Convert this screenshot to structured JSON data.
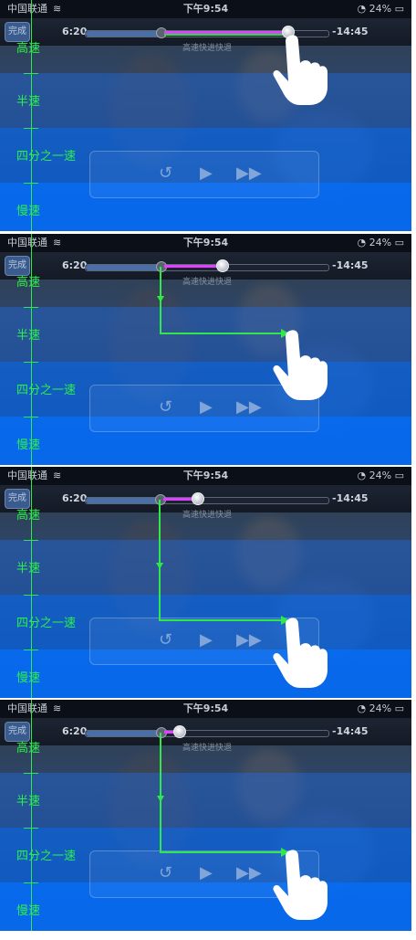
{
  "statusbar": {
    "carrier": "中国联通",
    "time": "下午9:54",
    "battery": "24%"
  },
  "player": {
    "done_label": "完成",
    "elapsed": "6:20",
    "remaining": "-14:45",
    "speed_caption": "高速快进快退"
  },
  "speed_labels": [
    "高速",
    "半速",
    "四分之一速",
    "慢速"
  ],
  "panels": [
    {
      "scrub_fraction": 0.85,
      "speed": "高速"
    },
    {
      "scrub_fraction": 0.33,
      "speed": "半速"
    },
    {
      "scrub_fraction": 0.19,
      "speed": "四分之一速"
    },
    {
      "scrub_fraction": 0.1,
      "speed": "四分之一速"
    }
  ],
  "colors": {
    "accent_green": "#2fe84a",
    "scrub_pink": "#e040ff",
    "band_blue": "#0a6ef0"
  },
  "icons": [
    "wifi-icon",
    "battery-icon",
    "replay-30-icon",
    "play-icon",
    "fast-forward-icon",
    "hand-pointer-icon"
  ]
}
